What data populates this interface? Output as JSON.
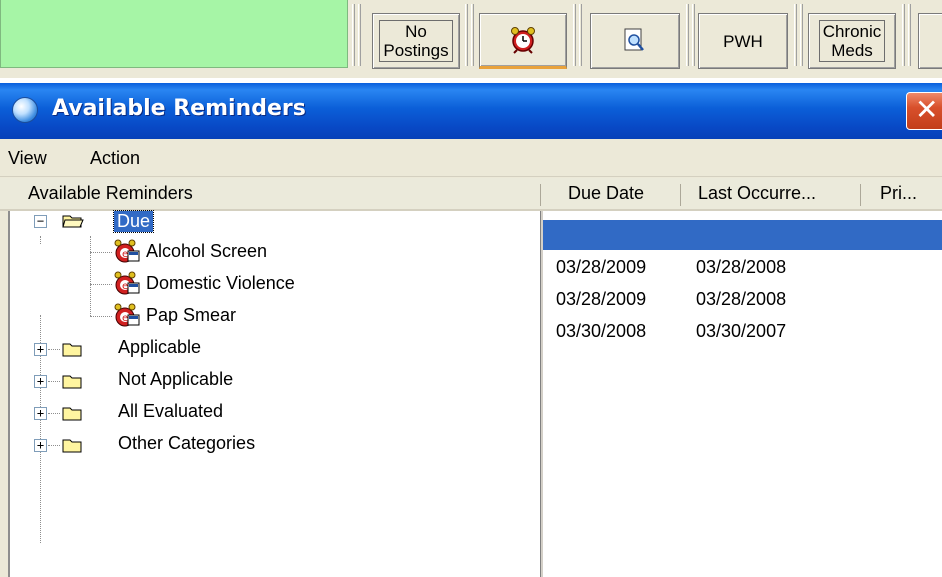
{
  "toolbar": {
    "buttons": [
      {
        "label_line1": "No",
        "label_line2": "Postings"
      },
      {
        "icon": "alarm-clock-icon"
      },
      {
        "icon": "magnifier-document-icon"
      },
      {
        "label": "PWH"
      },
      {
        "label_line1": "Chronic",
        "label_line2": "Meds"
      }
    ]
  },
  "dialog": {
    "title": "Available Reminders",
    "close_glyph": "✕",
    "menu": [
      "View",
      "Action"
    ],
    "columns": [
      "Available Reminders",
      "Due Date",
      "Last Occurre...",
      "Pri..."
    ],
    "tree": {
      "due": {
        "label": "Due",
        "children": [
          {
            "label": "Alcohol Screen",
            "due_date": "03/28/2009",
            "last_occurrence": "03/28/2008"
          },
          {
            "label": "Domestic Violence",
            "due_date": "03/28/2009",
            "last_occurrence": "03/28/2008"
          },
          {
            "label": "Pap Smear",
            "due_date": "03/30/2008",
            "last_occurrence": "03/30/2007"
          }
        ]
      },
      "categories": [
        "Applicable",
        "Not Applicable",
        "All Evaluated",
        "Other Categories"
      ]
    },
    "colors": {
      "title_blue": "#0b5fd8",
      "selection": "#316ac5",
      "green_panel": "#a6f5a6"
    }
  }
}
